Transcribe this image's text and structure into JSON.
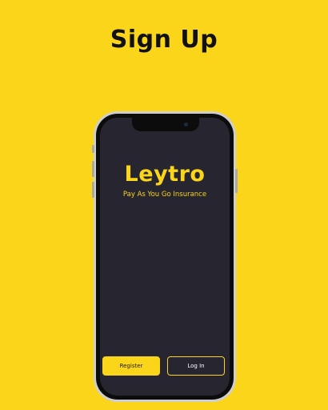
{
  "page": {
    "title": "Sign Up"
  },
  "app": {
    "name": "Leytro",
    "tagline": "Pay As You Go Insurance"
  },
  "actions": {
    "register_label": "Register",
    "login_label": "Log In"
  },
  "colors": {
    "background": "#fbd51a",
    "screen": "#262530",
    "accent": "#fbd51a"
  }
}
